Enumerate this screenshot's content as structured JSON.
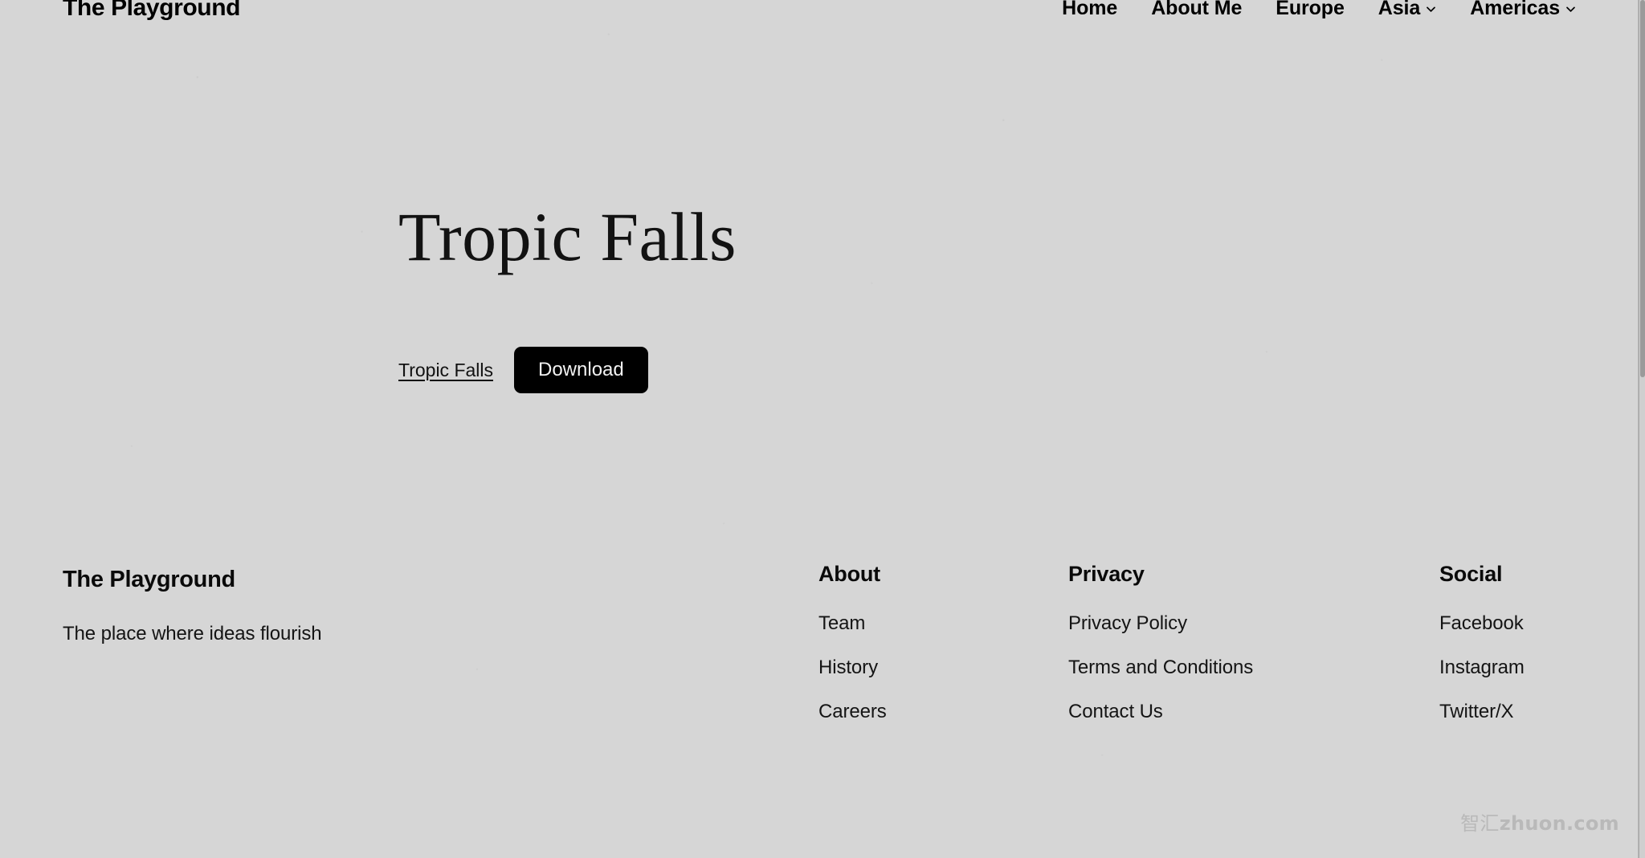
{
  "header": {
    "brand": "The Playground",
    "nav": [
      {
        "label": "Home",
        "has_dropdown": false
      },
      {
        "label": "About Me",
        "has_dropdown": false
      },
      {
        "label": "Europe",
        "has_dropdown": false
      },
      {
        "label": "Asia",
        "has_dropdown": true
      },
      {
        "label": "Americas",
        "has_dropdown": true
      }
    ]
  },
  "hero": {
    "title": "Tropic Falls",
    "link_label": "Tropic Falls",
    "download_label": "Download"
  },
  "footer": {
    "brand": "The Playground",
    "tagline": "The place where ideas flourish",
    "columns": [
      {
        "title": "About",
        "links": [
          "Team",
          "History",
          "Careers"
        ]
      },
      {
        "title": "Privacy",
        "links": [
          "Privacy Policy",
          "Terms and Conditions",
          "Contact Us"
        ]
      },
      {
        "title": "Social",
        "links": [
          "Facebook",
          "Instagram",
          "Twitter/X"
        ]
      }
    ]
  },
  "watermark": {
    "cn": "智汇",
    "en": "zhuon.com"
  },
  "colors": {
    "background": "#d6d6d6",
    "text": "#0d0d0d",
    "button_bg": "#000000",
    "button_text": "#f2f2f2",
    "watermark": "#b9b9b9"
  }
}
